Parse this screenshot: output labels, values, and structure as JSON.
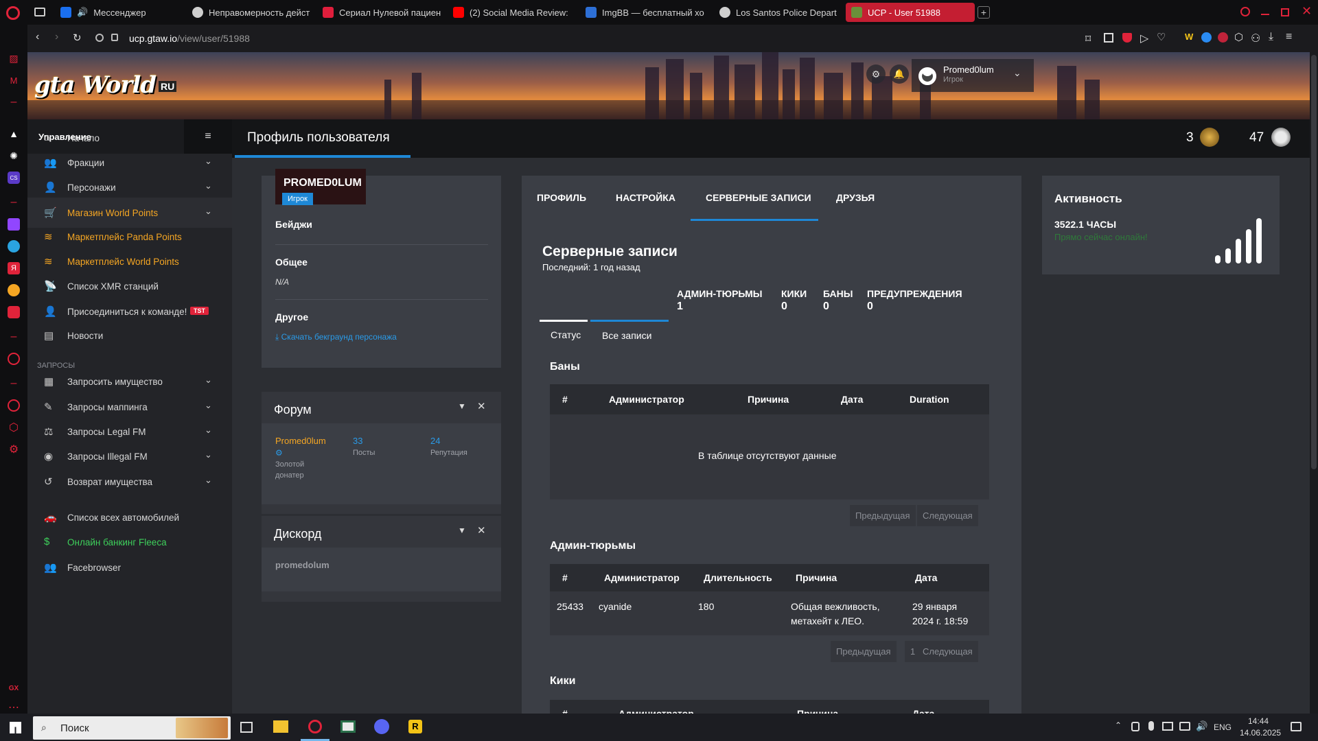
{
  "browser": {
    "tabs": [
      {
        "label": "Мессенджер",
        "color": "#1a6ff0"
      },
      {
        "label": "Неправомерность дейст",
        "color": "#cfcfcf"
      },
      {
        "label": "Сериал Нулевой пациен",
        "color": "#e01e3c"
      },
      {
        "label": "(2) Social Media Review:",
        "color": "#ff0000"
      },
      {
        "label": "ImgBB — бесплатный хо",
        "color": "#2d6fd6"
      },
      {
        "label": "Los Santos Police Depart",
        "color": "#cfcfcf"
      },
      {
        "label": "UCP - User 51988",
        "color": "#ffffff"
      }
    ],
    "url_host": "ucp.gtaw.io",
    "url_path": "/view/user/51988"
  },
  "header": {
    "logo_text": "gta World",
    "logo_suffix": "RU",
    "username": "Promed0lum",
    "role": "Игрок"
  },
  "page": {
    "title": "Профиль пользователя",
    "badge_count_1": "3",
    "badge_count_2": "47"
  },
  "sidebar": {
    "header": "Управление",
    "items": [
      {
        "label": "Начало",
        "icon": "home-icon",
        "chevron": false,
        "style": "normal"
      },
      {
        "label": "Фракции",
        "icon": "users-icon",
        "chevron": true,
        "style": "normal"
      },
      {
        "label": "Персонажи",
        "icon": "user-icon",
        "chevron": true,
        "style": "normal"
      },
      {
        "label": "Магазин World Points",
        "icon": "cart-icon",
        "chevron": true,
        "style": "orange",
        "active": true
      },
      {
        "label": "Маркетплейс Panda Points",
        "icon": "coins-icon",
        "chevron": false,
        "style": "orange"
      },
      {
        "label": "Маркетплейс World Points",
        "icon": "coins-icon",
        "chevron": false,
        "style": "orange"
      },
      {
        "label": "Список XMR станций",
        "icon": "antenna-icon",
        "chevron": false,
        "style": "normal"
      },
      {
        "label": "Присоединиться к команде!",
        "icon": "user-icon",
        "chevron": false,
        "style": "normal",
        "badge": "TST"
      },
      {
        "label": "Новости",
        "icon": "news-icon",
        "chevron": false,
        "style": "normal"
      }
    ],
    "section_label": "ЗАПРОСЫ",
    "requests": [
      {
        "label": "Запросить имущество",
        "icon": "building-icon",
        "chevron": true
      },
      {
        "label": "Запросы маппинга",
        "icon": "brush-icon",
        "chevron": true
      },
      {
        "label": "Запросы Legal FM",
        "icon": "scale-icon",
        "chevron": true
      },
      {
        "label": "Запросы Illegal FM",
        "icon": "mask-icon",
        "chevron": true
      },
      {
        "label": "Возврат имущества",
        "icon": "undo-icon",
        "chevron": true
      }
    ],
    "bottom": [
      {
        "label": "Список всех автомобилей",
        "icon": "car-icon",
        "style": "normal"
      },
      {
        "label": "Онлайн банкинг Fleeca",
        "icon": "money-icon",
        "style": "green"
      },
      {
        "label": "Facebrowser",
        "icon": "users-icon",
        "style": "normal"
      }
    ]
  },
  "profile": {
    "name": "PROMED0LUM",
    "role_badge": "Игрок",
    "badges_label": "Бейджи",
    "general_label": "Общее",
    "general_value": "N/A",
    "other_label": "Другое",
    "download_link": "Скачать бекграунд персонажа"
  },
  "forum": {
    "title": "Форум",
    "user": "Promed0lum",
    "rank_line1": "Золотой",
    "rank_line2": "донатер",
    "posts_value": "33",
    "posts_label": "Посты",
    "rep_value": "24",
    "rep_label": "Репутация"
  },
  "discord": {
    "title": "Дискорд",
    "user": "promedolum"
  },
  "tabs": [
    "ПРОФИЛЬ",
    "НАСТРОЙКА",
    "СЕРВЕРНЫЕ ЗАПИСИ",
    "ДРУЗЬЯ"
  ],
  "records": {
    "title": "Серверные записи",
    "last": "Последний: 1 год назад",
    "stats": [
      {
        "label": "АДМИН-ТЮРЬМЫ",
        "value": "1"
      },
      {
        "label": "КИКИ",
        "value": "0"
      },
      {
        "label": "БАНЫ",
        "value": "0"
      },
      {
        "label": "ПРЕДУПРЕЖДЕНИЯ",
        "value": "0"
      }
    ],
    "subtabs": [
      "Статус",
      "Все записи"
    ],
    "bans": {
      "title": "Баны",
      "columns": [
        "#",
        "Администратор",
        "Причина",
        "Дата",
        "Duration"
      ],
      "empty": "В таблице отсутствуют данные",
      "prev": "Предыдущая",
      "next": "Следующая"
    },
    "jails": {
      "title": "Админ-тюрьмы",
      "columns": [
        "#",
        "Администратор",
        "Длительность",
        "Причина",
        "Дата"
      ],
      "rows": [
        {
          "id": "25433",
          "admin": "cyanide",
          "duration": "180",
          "reason_1": "Общая вежливость,",
          "reason_2": "метахейт к ЛЕО.",
          "date_1": "29 января",
          "date_2": "2024 г. 18:59"
        }
      ],
      "prev": "Предыдущая",
      "page": "1",
      "next": "Следующая"
    },
    "kicks": {
      "title": "Кики",
      "columns": [
        "#",
        "Администратор",
        "Причина",
        "Дата"
      ]
    }
  },
  "activity": {
    "title": "Активность",
    "hours": "3522.1 ЧАСЫ",
    "online": "Прямо сейчас онлайн!"
  },
  "taskbar": {
    "search": "Поиск",
    "lang": "ENG",
    "time": "14:44",
    "date": "14.06.2025"
  }
}
